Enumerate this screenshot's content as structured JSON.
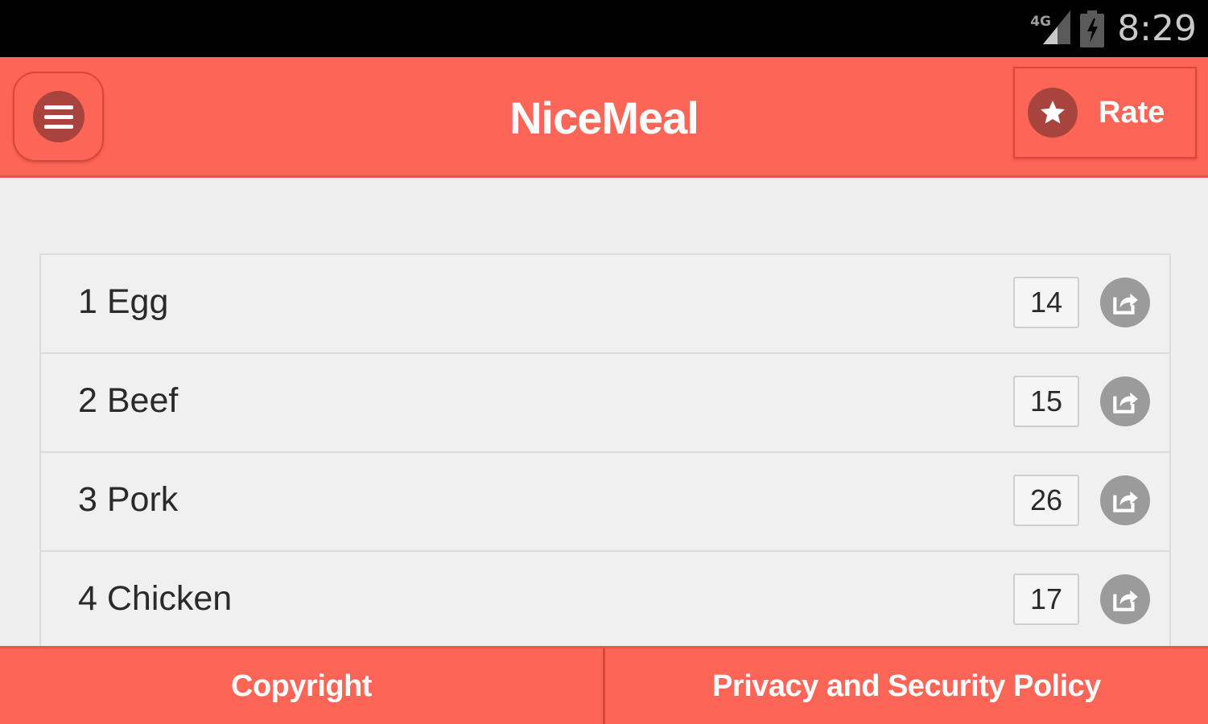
{
  "status_bar": {
    "network": "4G",
    "time": "8:29"
  },
  "header": {
    "title": "NiceMeal",
    "menu_icon": "hamburger-menu-icon",
    "rate_label": "Rate",
    "rate_icon": "star-icon"
  },
  "list": {
    "items": [
      {
        "label": "1 Egg",
        "count": "14"
      },
      {
        "label": "2 Beef",
        "count": "15"
      },
      {
        "label": "3 Pork",
        "count": "26"
      },
      {
        "label": "4 Chicken",
        "count": "17"
      }
    ]
  },
  "footer": {
    "copyright_label": "Copyright",
    "privacy_label": "Privacy and Security Policy"
  },
  "colors": {
    "accent": "#fd6556",
    "accent_dark": "#a8433d",
    "background": "#efefef"
  }
}
